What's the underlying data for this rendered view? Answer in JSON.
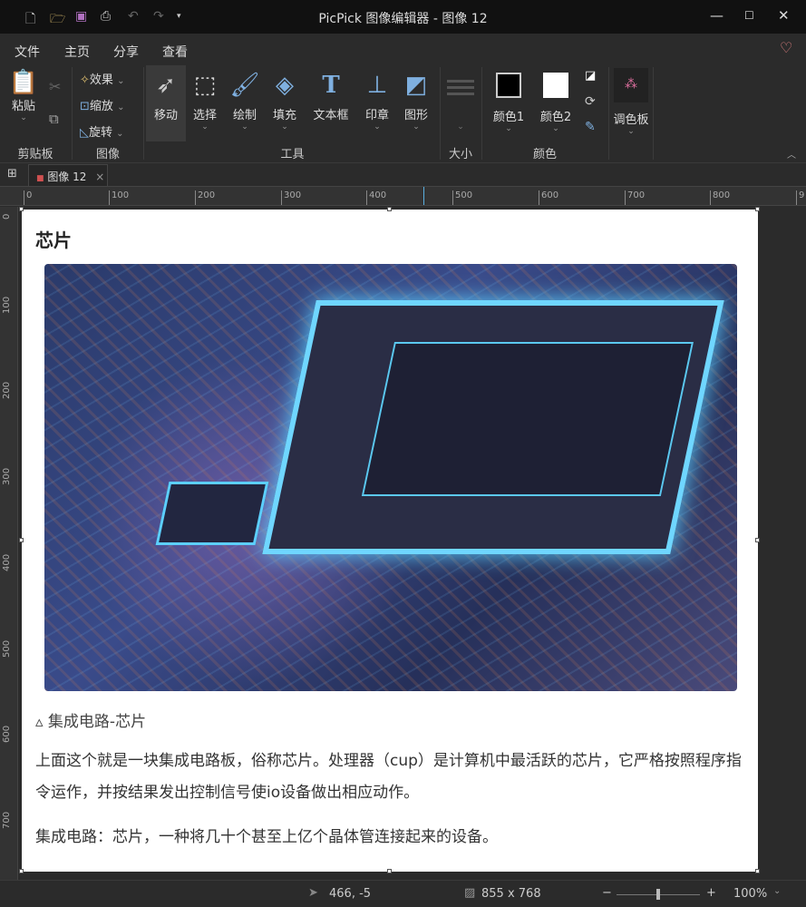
{
  "window": {
    "title": "PicPick 图像编辑器 - 图像 12",
    "minimize": "—",
    "maximize": "☐",
    "close": "✕"
  },
  "menu": [
    "文件",
    "主页",
    "分享",
    "查看"
  ],
  "ribbon": {
    "clipboard": {
      "paste": "粘贴",
      "group": "剪贴板"
    },
    "image": {
      "effects": "效果",
      "resize": "缩放",
      "rotate": "旋转",
      "group": "图像"
    },
    "tools": {
      "items": [
        "移动",
        "选择",
        "绘制",
        "填充",
        "文本框",
        "印章",
        "图形"
      ],
      "group": "工具"
    },
    "size": {
      "group": "大小"
    },
    "color": {
      "color1": "颜色1",
      "color2": "颜色2",
      "group": "颜色"
    },
    "palette": {
      "label": "调色板"
    }
  },
  "tab": {
    "label": "图像 12",
    "close": "×"
  },
  "ruler": {
    "h": [
      "0",
      "100",
      "200",
      "300",
      "400",
      "500",
      "600",
      "700",
      "800",
      "9"
    ],
    "v": [
      "0",
      "100",
      "200",
      "300",
      "400",
      "500",
      "600",
      "700"
    ]
  },
  "document": {
    "heading": "芯片",
    "caption": "▵ 集成电路-芯片",
    "para1": "上面这个就是一块集成电路板，俗称芯片。处理器（cup）是计算机中最活跃的芯片，它严格按照程序指令运作，并按结果发出控制信号使io设备做出相应动作。",
    "para2": "集成电路：芯片，一种将几十个甚至上亿个晶体管连接起来的设备。"
  },
  "status": {
    "cursor": "466, -5",
    "size": "855 x 768",
    "zoom": "100%",
    "zoom_minus": "−",
    "zoom_plus": "+",
    "zoom_level": 0.5
  }
}
